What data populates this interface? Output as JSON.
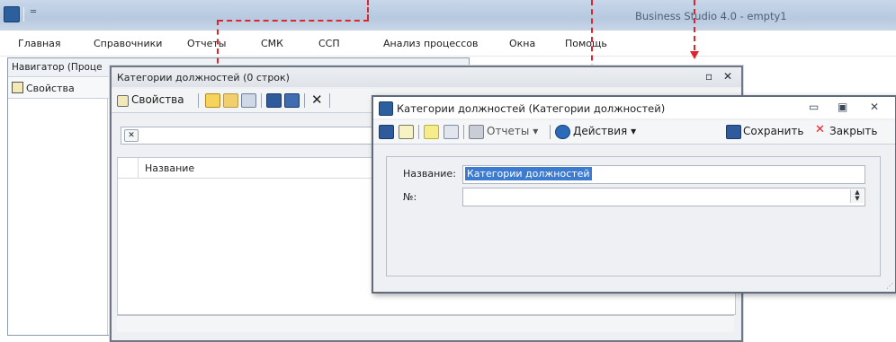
{
  "app": {
    "title": "Business Studio 4.0 - empty1",
    "qat_glyph": "═"
  },
  "menu": [
    {
      "label": "Главная"
    },
    {
      "label": "Справочники"
    },
    {
      "label": "Отчеты"
    },
    {
      "label": "СМК"
    },
    {
      "label": "ССП"
    },
    {
      "label": "Анализ процессов"
    },
    {
      "label": "Окна"
    },
    {
      "label": "Помощь"
    }
  ],
  "navigator": {
    "title": "Навигатор (Проце",
    "properties_label": "Свойства"
  },
  "list_window": {
    "title": "Категории должностей (0 строк)",
    "properties_label": "Свойства",
    "filter_clear_glyph": "✕",
    "column_header": "Название",
    "delete_glyph": "✕",
    "restore_glyph": "▫",
    "close_glyph": "✕"
  },
  "dialog": {
    "title": "Категории должностей (Категории должностей)",
    "reports_label": "Отчеты",
    "actions_label": "Действия",
    "save_label": "Сохранить",
    "close_label": "Закрыть",
    "minimize_glyph": "▭",
    "maximize_glyph": "▣",
    "close_glyph": "✕",
    "dropdown_glyph": "▾",
    "fields": {
      "name_label": "Название:",
      "name_value": "Категории должностей",
      "number_label": "№:",
      "number_value": ""
    }
  },
  "colors": {
    "annotation": "#e0242c",
    "selection": "#3d7bd1"
  }
}
